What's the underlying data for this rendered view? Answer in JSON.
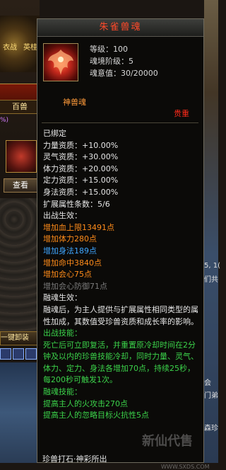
{
  "background": {
    "banner_left": "衣战",
    "banner_right": "英桂",
    "hundred_beasts": "百兽",
    "percent_fragment": "%)",
    "view_button": "查看",
    "one_key": "一键卸装",
    "right_texts": [
      "5, 1(",
      "们共",
      "会",
      "门弟",
      "森珍"
    ]
  },
  "tooltip": {
    "title": "朱雀兽魂",
    "meta": {
      "level": "等级：100",
      "realm": "魂境阶级：5",
      "will": "魂意值：30/20000"
    },
    "subtitle": "神兽魂",
    "quality": "贵重",
    "bound": "已绑定",
    "stats": [
      "力量资质：+10.00%",
      "灵气资质：+30.00%",
      "体力资质：+20.00%",
      "定力资质：+15.00%",
      "身法资质：+15.00%",
      "扩展属性条数：5/6"
    ],
    "battle_effect_label": "出战生效：",
    "battle_effects": [
      {
        "text": "增加血上限13491点",
        "tone": "orange"
      },
      {
        "text": "增加体力280点",
        "tone": "orange"
      },
      {
        "text": "增加身法189点",
        "tone": "blue"
      },
      {
        "text": "增加命中3840点",
        "tone": "orange"
      },
      {
        "text": "增加会心75点",
        "tone": "orange"
      },
      {
        "text": "增加会心防御71点",
        "tone": "grey"
      }
    ],
    "fuse_effect_label": "融魂生效：",
    "fuse_desc": "融魂后，为主人提供与扩展属性相同类型的属性加成，其数值受珍兽资质和成长率的影响。",
    "battle_skill_label": "出战技能：",
    "battle_skill_desc": "死亡后可立即复活，并重置原冷却时间在2分钟及以内的珍兽技能冷却，同时力量、灵气、体力、定力、身法各增加70点，持续25秒，每200秒可触发1次。",
    "fuse_skill_label": "融魂技能：",
    "fuse_skills": [
      "提高主人的火攻击270点",
      "提高主人的忽略目标火抗性5点"
    ],
    "watermark": "新仙代售",
    "watermark_url": "WWW.SXDS.COM",
    "footer": "珍兽打石·神彩所出"
  },
  "colors": {
    "title": "#ff4a2a",
    "orange": "#ff8c1a",
    "blue": "#3fa6ff",
    "grey": "#7a7a7a",
    "green": "#3bd24a",
    "quality": "#ff2a1a"
  }
}
